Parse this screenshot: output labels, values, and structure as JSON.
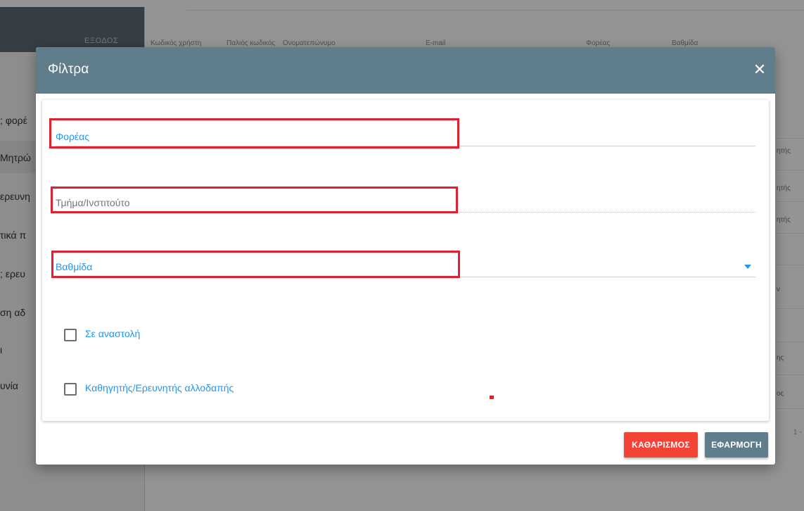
{
  "background": {
    "logout_label": "ΕΞΟΔΟΣ",
    "sidebar_items": [
      "; φορέ",
      "Μητρώ",
      "ερευνη",
      "τικά π",
      "; ερευ",
      "ση αδ",
      "ι",
      "υνία"
    ],
    "table_headers": [
      "Κωδικός χρήστη",
      "Παλιός κωδικός",
      "Ονοματεπώνυμο",
      "E-mail",
      "Φορέας",
      "Βαθμίδα"
    ],
    "row_fragments": [
      "ητής",
      "ητής",
      "ητής",
      "ν",
      "ης",
      "ος"
    ],
    "pagination": "1 -"
  },
  "dialog": {
    "title": "Φίλτρα",
    "close_symbol": "✕",
    "fields": {
      "foreas_label": "Φορέας",
      "tmima_label": "Τμήμα/Ινστιτούτο",
      "vathmida_label": "Βαθμίδα"
    },
    "checkboxes": {
      "suspension_label": "Σε αναστολή",
      "foreign_label": "Καθηγητής/Ερευνητής αλλοδαπής"
    },
    "buttons": {
      "clear_label": "ΚΑΘΑΡΙΣΜΟΣ",
      "apply_label": "ΕΦΑΡΜΟΓΗ"
    }
  },
  "colors": {
    "header": "#607d8b",
    "accent": "#2196f3",
    "highlight": "#e0202f",
    "clear_button": "#f44336"
  }
}
